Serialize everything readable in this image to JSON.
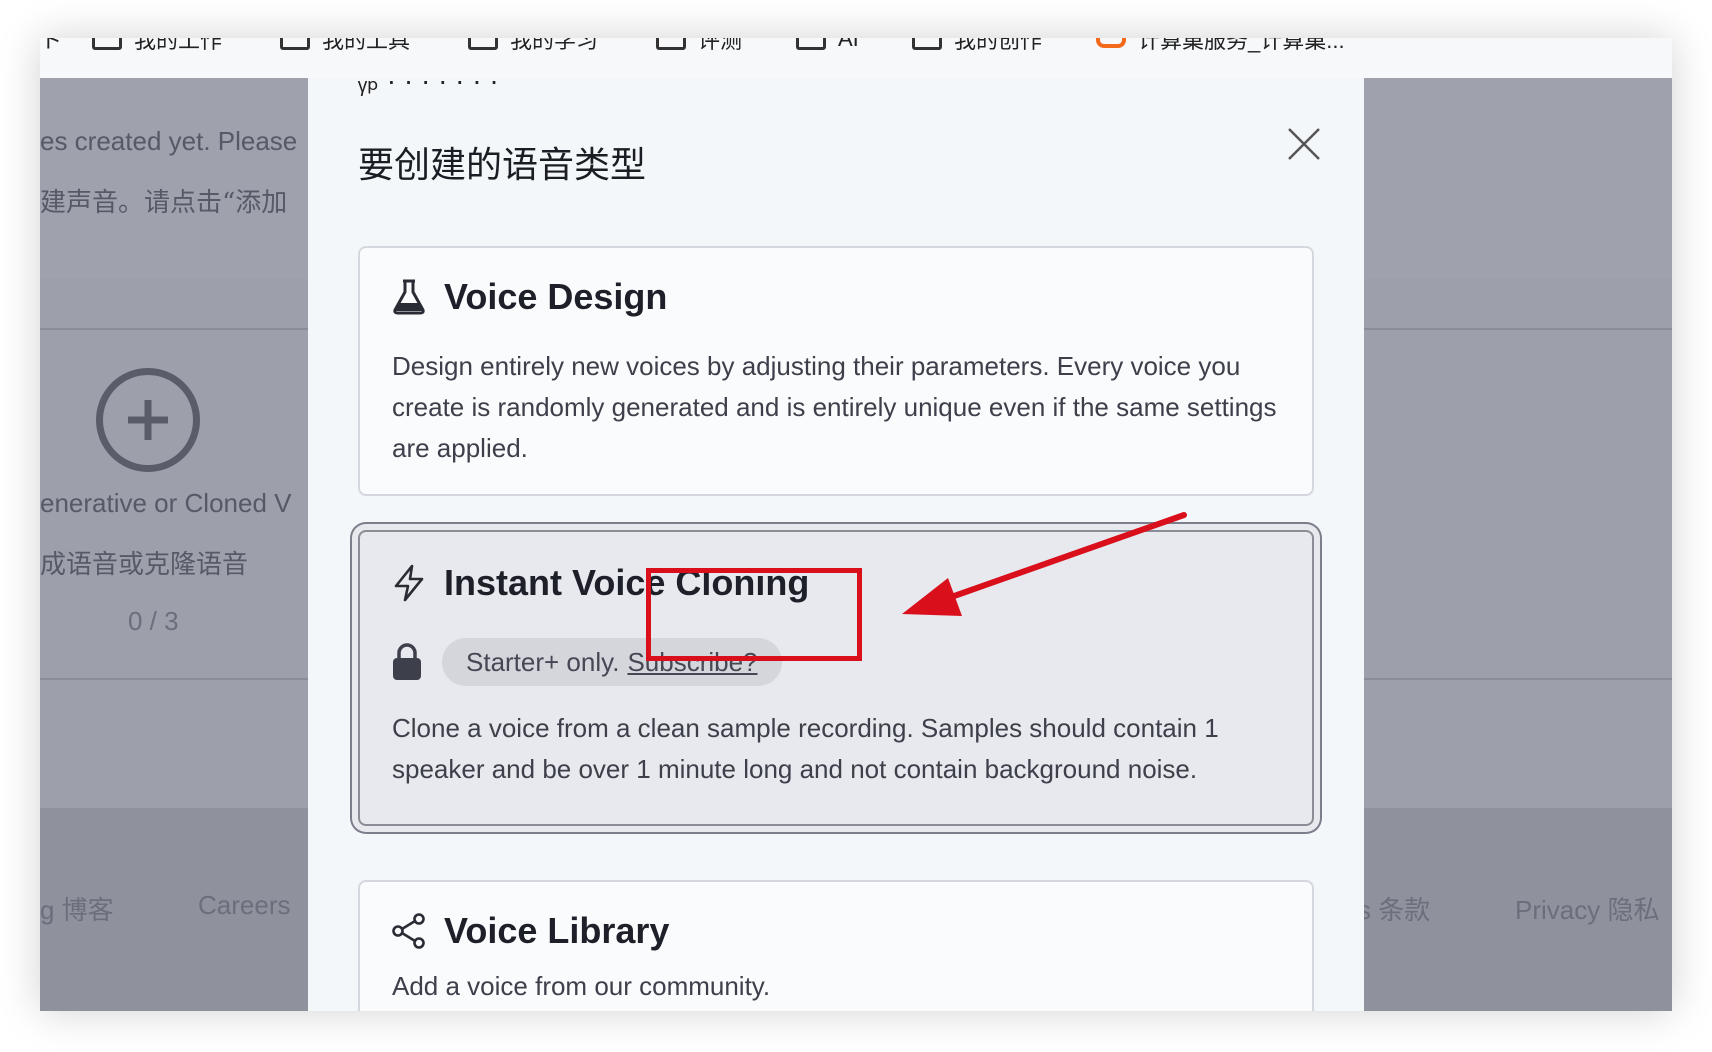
{
  "bookmarks": [
    {
      "label": "我的工作",
      "icon": "folder-icon"
    },
    {
      "label": "我的工具",
      "icon": "folder-icon"
    },
    {
      "label": "我的学习",
      "icon": "folder-icon"
    },
    {
      "label": "评测",
      "icon": "folder-icon"
    },
    {
      "label": "AI",
      "icon": "folder-icon"
    },
    {
      "label": "我的创作",
      "icon": "folder-icon"
    },
    {
      "label": "计算巢服务_计算巢...",
      "icon": "cloud-service-icon"
    }
  ],
  "background": {
    "notice_en": "es created yet. Please",
    "notice_zh": "建声音。请点击“添加",
    "add_label_en": "enerative or Cloned V",
    "add_label_zh": "成语音或克隆语音",
    "counter": "0 / 3",
    "footer": {
      "blog": "g 博客",
      "careers": "Careers",
      "terms": "s 条款",
      "privacy": "Privacy 隐私"
    }
  },
  "modal": {
    "title": "要创建的语音类型",
    "options": [
      {
        "title": "Voice Design",
        "icon": "flask-icon",
        "description": "Design entirely new voices by adjusting their parameters. Every voice you create is randomly generated and is entirely unique even if the same settings are applied."
      },
      {
        "title": "Instant Voice Cloning",
        "icon": "lightning-icon",
        "locked_text": "Starter+ only.",
        "subscribe_link": "Subscribe?",
        "description": "Clone a voice from a clean sample recording. Samples should contain 1 speaker and be over 1 minute long and not contain background noise."
      },
      {
        "title": "Voice Library",
        "icon": "share-icon",
        "description": "Add a voice from our community."
      }
    ]
  },
  "annotation": {
    "color": "#d90f1c"
  }
}
